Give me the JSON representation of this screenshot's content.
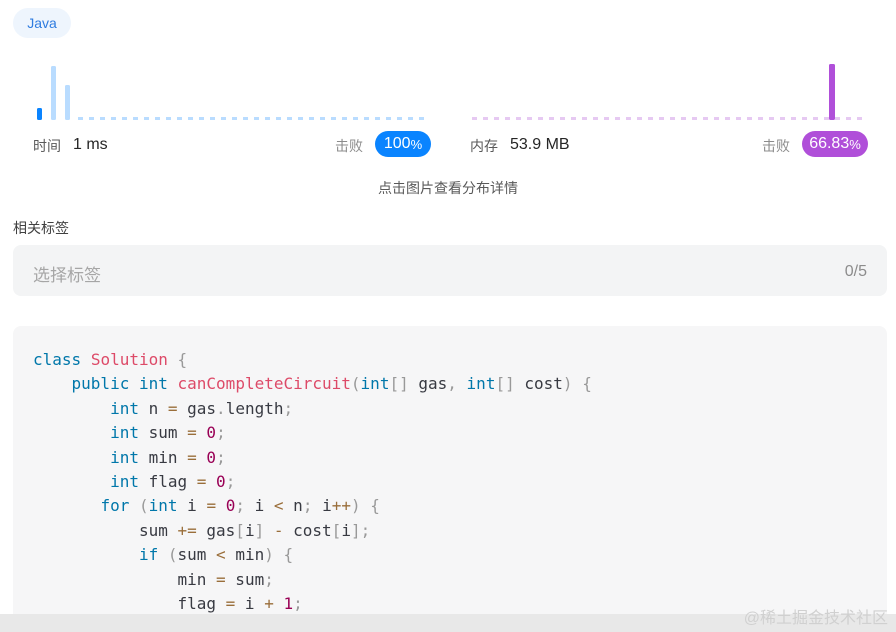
{
  "language_tag": "Java",
  "runtime": {
    "label": "时间",
    "value": "1 ms",
    "beat_label": "击败",
    "beat_value": "100",
    "beat_unit": "%",
    "color": "#0a84ff"
  },
  "memory": {
    "label": "内存",
    "value": "53.9 MB",
    "beat_label": "击败",
    "beat_value": "66.83",
    "beat_unit": "%",
    "color": "#b04fd9"
  },
  "hint": "点击图片查看分布详情",
  "tags": {
    "title": "相关标签",
    "placeholder": "选择标签",
    "count": "0/5"
  },
  "code": {
    "language": "java",
    "lines": [
      "class Solution {",
      "    public int canCompleteCircuit(int[] gas, int[] cost) {",
      "        int n = gas.length;",
      "        int sum = 0;",
      "        int min = 0;",
      "        int flag = 0;",
      "       for (int i = 0; i < n; i++) {",
      "           sum += gas[i] - cost[i];",
      "           if (sum < min) {",
      "               min = sum;",
      "               flag = i + 1;"
    ]
  },
  "watermark": "@稀土掘金技术社区"
}
